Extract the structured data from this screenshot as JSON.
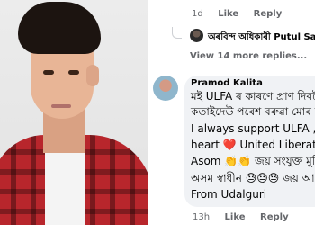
{
  "thread": {
    "top_meta": {
      "time": "1d",
      "like": "Like",
      "reply": "Reply"
    },
    "reply_preview": {
      "author": "অৰবিন্দ অধিকাৰী Putul Sa"
    },
    "view_more": "View 14 more replies..."
  },
  "comment": {
    "author": "Pramod Kalita",
    "lines": [
      "মই ULFA ৰ কাৰণে প্ৰাণ দিবলৈ",
      "কতাইদেউ পৰেশ বৰুৱা মোৰ জী",
      "I always support ULFA ,,, lo",
      "heart ❤️ United Liberation",
      "Asom 👏👏 জয় সংযুক্ত মুক্তি",
      "অসম স্বাধীন 😓😓😓 জয় আই",
      "From Udalguri"
    ],
    "meta": {
      "time": "13h",
      "like": "Like",
      "reply": "Reply"
    }
  }
}
